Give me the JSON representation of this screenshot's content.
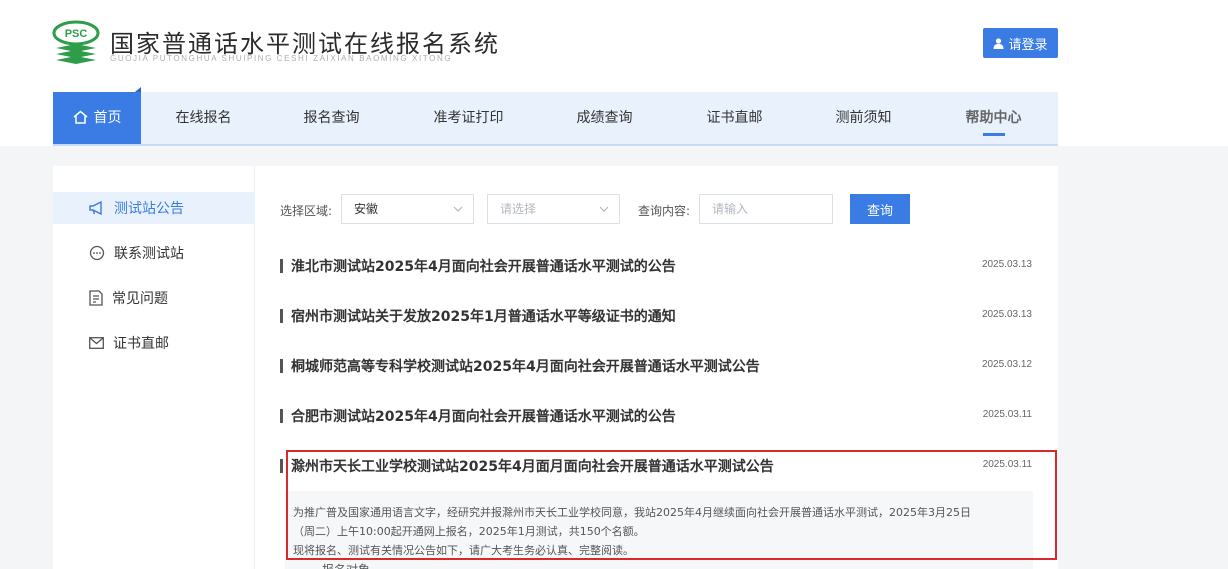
{
  "header": {
    "logo_text": "PSC",
    "site_title": "国家普通话水平测试在线报名系统",
    "site_subtitle": "GUOJIA PUTONGHUA SHUIPING CESHI ZAIXIAN BAOMING XITONG",
    "login_label": "请登录"
  },
  "nav": {
    "items": [
      {
        "label": "首页"
      },
      {
        "label": "在线报名"
      },
      {
        "label": "报名查询"
      },
      {
        "label": "准考证打印"
      },
      {
        "label": "成绩查询"
      },
      {
        "label": "证书直邮"
      },
      {
        "label": "测前须知"
      },
      {
        "label": "帮助中心"
      }
    ]
  },
  "sidebar": {
    "items": [
      {
        "label": "测试站公告"
      },
      {
        "label": "联系测试站"
      },
      {
        "label": "常见问题"
      },
      {
        "label": "证书直邮"
      }
    ]
  },
  "filter": {
    "region_label": "选择区域:",
    "region_value": "安徽",
    "city_placeholder": "请选择",
    "query_label": "查询内容:",
    "query_placeholder": "请输入",
    "query_button": "查询"
  },
  "notices": [
    {
      "title": "淮北市测试站2025年4月面向社会开展普通话水平测试的公告",
      "date": "2025.03.13"
    },
    {
      "title": "宿州市测试站关于发放2025年1月普通话水平等级证书的通知",
      "date": "2025.03.13"
    },
    {
      "title": "桐城师范高等专科学校测试站2025年4月面向社会开展普通话水平测试公告",
      "date": "2025.03.12"
    },
    {
      "title": "合肥市测试站2025年4月面向社会开展普通话水平测试的公告",
      "date": "2025.03.11"
    },
    {
      "title": "滁州市天长工业学校测试站2025年4月面月面向社会开展普通话水平测试公告",
      "date": "2025.03.11"
    }
  ],
  "excerpt": {
    "line1": "为推广普及国家通用语言文字，经研究并报滁州市天长工业学校同意，我站2025年4月继续面向社会开展普通话水平测试，2025年3月25日",
    "line2": "（周二）上午10:00起开通网上报名，2025年1月测试，共150个名额。",
    "line3": "现将报名、测试有关情况公告如下，请广大考生务必认真、完整阅读。"
  },
  "trailing_text": "一、报名对象",
  "colors": {
    "accent": "#3a7ce3",
    "highlight": "#d8292b"
  }
}
